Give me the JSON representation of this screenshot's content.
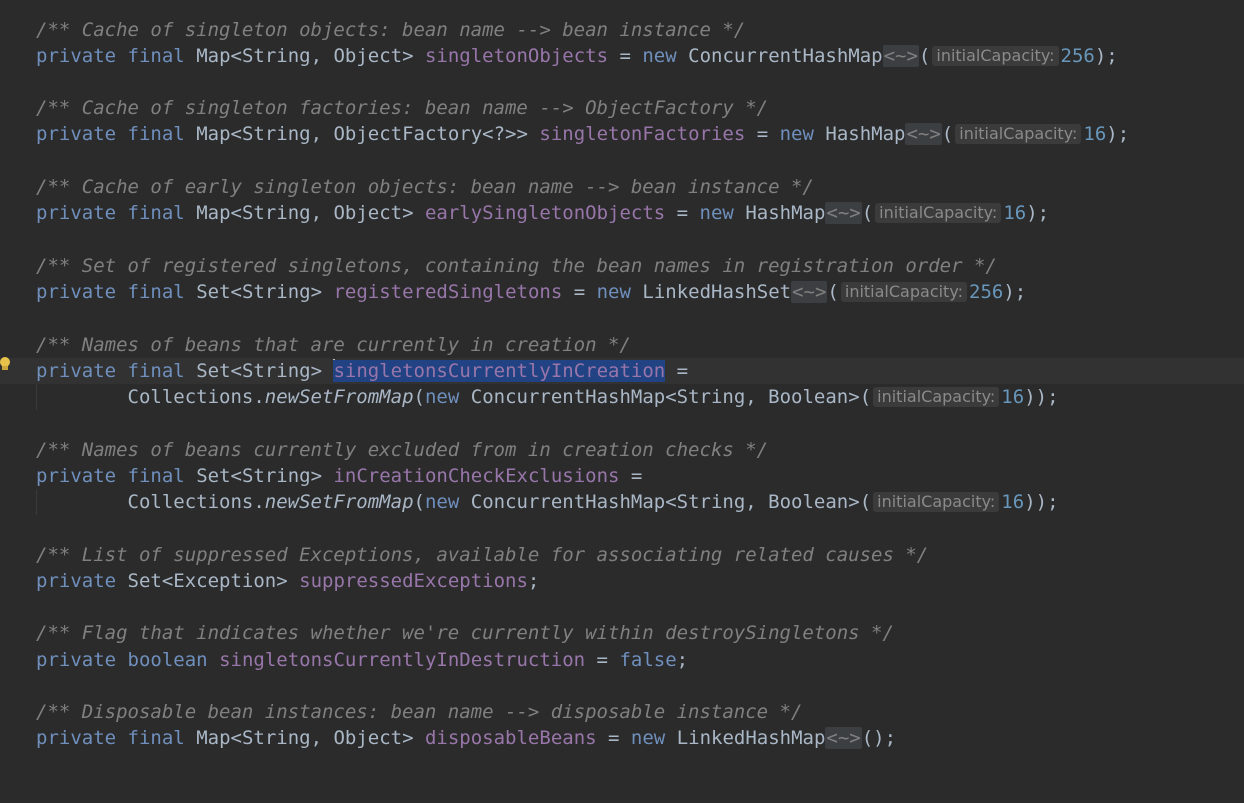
{
  "c1": "/** Cache of singleton objects: bean name --> bean instance */",
  "c2": "/** Cache of singleton factories: bean name --> ObjectFactory */",
  "c3": "/** Cache of early singleton objects: bean name --> bean instance */",
  "c4": "/** Set of registered singletons, containing the bean names in registration order */",
  "c5": "/** Names of beans that are currently in creation */",
  "c6": "/** Names of beans currently excluded from in creation checks */",
  "c7": "/** List of suppressed Exceptions, available for associating related causes */",
  "c8": "/** Flag that indicates whether we're currently within destroySingletons */",
  "c9": "/** Disposable bean instances: bean name --> disposable instance */",
  "kw_private": "private",
  "kw_final": "final",
  "kw_new": "new",
  "kw_boolean": "boolean",
  "kw_false": "false",
  "t_map_so": "Map<String, Object>",
  "t_map_sf": "Map<String, ObjectFactory<?>>",
  "t_set_s": "Set<String>",
  "t_set_e": "Set<Exception>",
  "f_singletonObjects": "singletonObjects",
  "f_singletonFactories": "singletonFactories",
  "f_earlySingletonObjects": "earlySingletonObjects",
  "f_registeredSingletons": "registeredSingletons",
  "f_singletonsCurrentlyInCreation": "singletonsCurrentlyInCreation",
  "f_inCreationCheckExclusions": "inCreationCheckExclusions",
  "f_suppressedExceptions": "suppressedExceptions",
  "f_singletonsCurrentlyInDestruction": "singletonsCurrentlyInDestruction",
  "f_disposableBeans": "disposableBeans",
  "cls_chm": "ConcurrentHashMap",
  "cls_hm": "HashMap",
  "cls_lhs": "LinkedHashSet",
  "cls_lhm": "LinkedHashMap",
  "cls_chm_sb": "ConcurrentHashMap<String, Boolean>",
  "collections": "Collections.",
  "newSetFromMap": "newSetFromMap",
  "diamond": "<~>",
  "hint_label": "initialCapacity:",
  "n256": "256",
  "n16": "16"
}
